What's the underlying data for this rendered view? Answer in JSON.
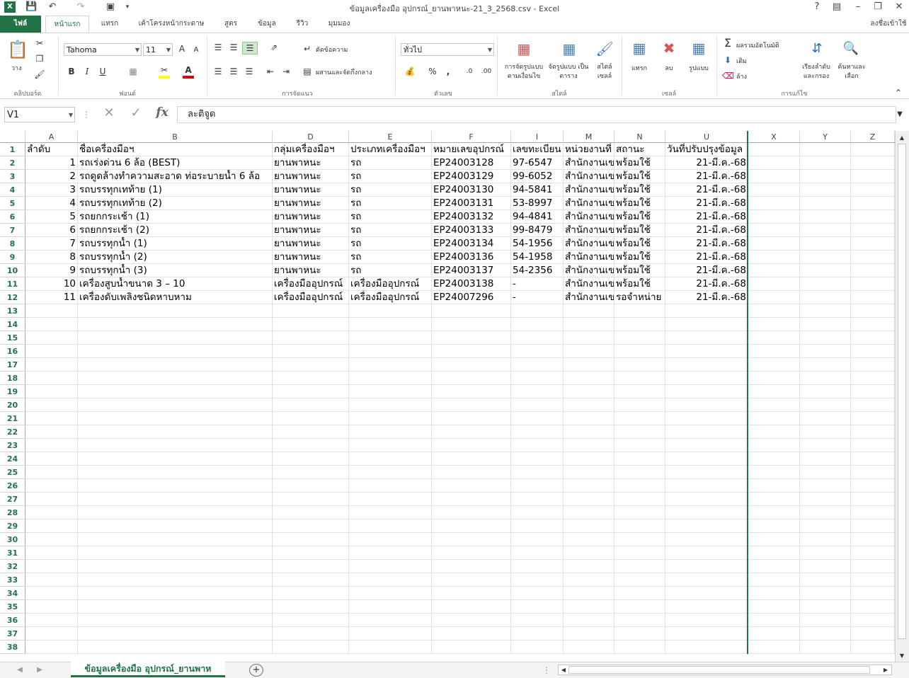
{
  "window": {
    "title": "ข้อมูลเครื่องมือ อุปกรณ์_ยานพาหนะ-21_3_2568.csv - Excel",
    "help": "?",
    "signin": "ลงชื่อเข้าใช้"
  },
  "tabs": [
    "ไฟล์",
    "หน้าแรก",
    "แทรก",
    "เค้าโครงหน้ากระดาษ",
    "สูตร",
    "ข้อมูล",
    "รีวิว",
    "มุมมอง"
  ],
  "ribbon": {
    "clipboard": {
      "paste": "วาง",
      "label": "คลิปบอร์ด"
    },
    "font": {
      "name": "Tahoma",
      "size": "11",
      "label": "ฟอนต์",
      "bold": "B",
      "italic": "I",
      "underline": "U"
    },
    "alignment": {
      "wrap": "ตัดข้อความ",
      "merge": "ผสานและจัดกึ่งกลาง",
      "label": "การจัดแนว"
    },
    "number": {
      "format": "ทั่วไป",
      "percent": "%",
      "comma": ",",
      "label": "ตัวเลข"
    },
    "styles": {
      "conditional": "การจัดรูปแบบ ตามเงื่อนไข",
      "table": "จัดรูปแบบ เป็นตาราง",
      "cell": "สไตล์ เซลล์",
      "label": "สไตล์"
    },
    "cells": {
      "insert": "แทรก",
      "delete": "ลบ",
      "format": "รูปแบบ",
      "label": "เซลล์"
    },
    "editing": {
      "autosum": "ผลรวมอัตโนมัติ",
      "fill": "เติม",
      "clear": "ล้าง",
      "sort": "เรียงลำดับ และกรอง",
      "find": "ค้นหาและ เลือก",
      "label": "การแก้ไข"
    }
  },
  "formula_bar": {
    "namebox": "V1",
    "content": "ละติจูด",
    "fx": "fx"
  },
  "columns": [
    "A",
    "B",
    "D",
    "E",
    "F",
    "I",
    "M",
    "N",
    "U",
    "X",
    "Y",
    "Z"
  ],
  "rows": [
    [
      "ลำดับ",
      "ชื่อเครื่องมือฯ",
      "กลุ่มเครื่องมือฯ",
      "ประเภทเครื่องมือฯ",
      "หมายเลขอุปกรณ์",
      "เลขทะเบียน",
      "หน่วยงานที่",
      "สถานะ",
      "วันที่ปรับปรุงข้อมูล"
    ],
    [
      "1",
      "รถเร่งด่วน 6 ล้อ (BEST)",
      "ยานพาหนะ",
      "รถ",
      "EP24003128",
      "97-6547",
      "สำนักงานเข",
      "พร้อมใช้",
      "21-มี.ค.-68"
    ],
    [
      "2",
      "รถดูดล้างทำความสะอาด ท่อระบายน้ำ 6 ล้อ",
      "ยานพาหนะ",
      "รถ",
      "EP24003129",
      "99-6052",
      "สำนักงานเข",
      "พร้อมใช้",
      "21-มี.ค.-68"
    ],
    [
      "3",
      "รถบรรทุกเทท้าย (1)",
      "ยานพาหนะ",
      "รถ",
      "EP24003130",
      "94-5841",
      "สำนักงานเข",
      "พร้อมใช้",
      "21-มี.ค.-68"
    ],
    [
      "4",
      "รถบรรทุกเทท้าย (2)",
      "ยานพาหนะ",
      "รถ",
      "EP24003131",
      "53-8997",
      "สำนักงานเข",
      "พร้อมใช้",
      "21-มี.ค.-68"
    ],
    [
      "5",
      "รถยกกระเช้า (1)",
      "ยานพาหนะ",
      "รถ",
      "EP24003132",
      "94-4841",
      "สำนักงานเข",
      "พร้อมใช้",
      "21-มี.ค.-68"
    ],
    [
      "6",
      "รถยกกระเช้า (2)",
      "ยานพาหนะ",
      "รถ",
      "EP24003133",
      "99-8479",
      "สำนักงานเข",
      "พร้อมใช้",
      "21-มี.ค.-68"
    ],
    [
      "7",
      "รถบรรทุกน้ำ (1)",
      "ยานพาหนะ",
      "รถ",
      "EP24003134",
      "54-1956",
      "สำนักงานเข",
      "พร้อมใช้",
      "21-มี.ค.-68"
    ],
    [
      "8",
      "รถบรรทุกน้ำ (2)",
      "ยานพาหนะ",
      "รถ",
      "EP24003136",
      "54-1958",
      "สำนักงานเข",
      "พร้อมใช้",
      "21-มี.ค.-68"
    ],
    [
      "9",
      "รถบรรทุกน้ำ (3)",
      "ยานพาหนะ",
      "รถ",
      "EP24003137",
      "54-2356",
      "สำนักงานเข",
      "พร้อมใช้",
      "21-มี.ค.-68"
    ],
    [
      "10",
      "เครื่องสูบน้ำขนาด 3 – 10",
      "เครื่องมืออุปกรณ์",
      "เครื่องมืออุปกรณ์",
      "EP24003138",
      "-",
      "สำนักงานเข",
      "พร้อมใช้",
      "21-มี.ค.-68"
    ],
    [
      "11",
      "เครื่องดับเพลิงชนิดหาบหาม",
      "เครื่องมืออุปกรณ์",
      "เครื่องมืออุปกรณ์",
      "EP24007296",
      "-",
      "สำนักงานเข",
      "รอจำหน่าย",
      "21-มี.ค.-68"
    ]
  ],
  "sheet_tab": "ข้อมูลเครื่องมือ อุปกรณ์_ยานพาห"
}
